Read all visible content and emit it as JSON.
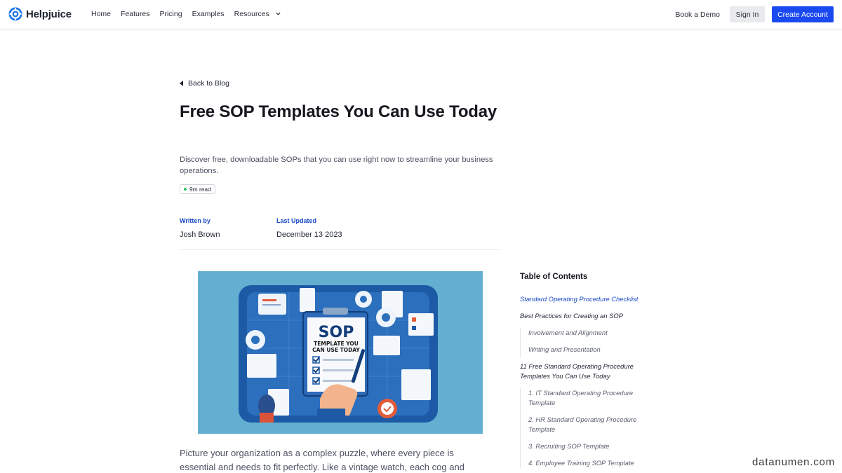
{
  "brand": {
    "name": "Helpjuice",
    "accent": "#1a49f0"
  },
  "nav": {
    "links": [
      "Home",
      "Features",
      "Pricing",
      "Examples",
      "Resources"
    ],
    "book_demo": "Book a Demo",
    "sign_in": "Sign In",
    "create_account": "Create Account"
  },
  "article": {
    "back_label": "Back to Blog",
    "title": "Free SOP Templates You Can Use Today",
    "subtitle": "Discover free, downloadable SOPs that you can use right now to streamline your business operations.",
    "read_time": "9m read",
    "written_by_label": "Written by",
    "author": "Josh Brown",
    "last_updated_label": "Last Updated",
    "updated_date": "December 13 2023",
    "hero_text_1": "SOP",
    "hero_text_2": "TEMPLATE YOU",
    "hero_text_3": "CAN USE TODAY",
    "body_preview": "Picture your organization as a complex puzzle, where every piece is essential and needs to fit perfectly. Like a vintage watch, each cog and"
  },
  "toc": {
    "title": "Table of Contents",
    "items": [
      "Standard Operating Procedure Checklist",
      "Best Practices for Creating an SOP",
      "Involvement and Alignment",
      "Writing and Presentation",
      "11 Free Standard Operating Procedure Templates You Can Use Today",
      "1. IT Standard Operating Procedure Template",
      "2. HR Standard Operating Procedure Template",
      "3. Recruiting SOP Template",
      "4. Employee Training SOP Template"
    ]
  },
  "watermark": "datanumen.com"
}
